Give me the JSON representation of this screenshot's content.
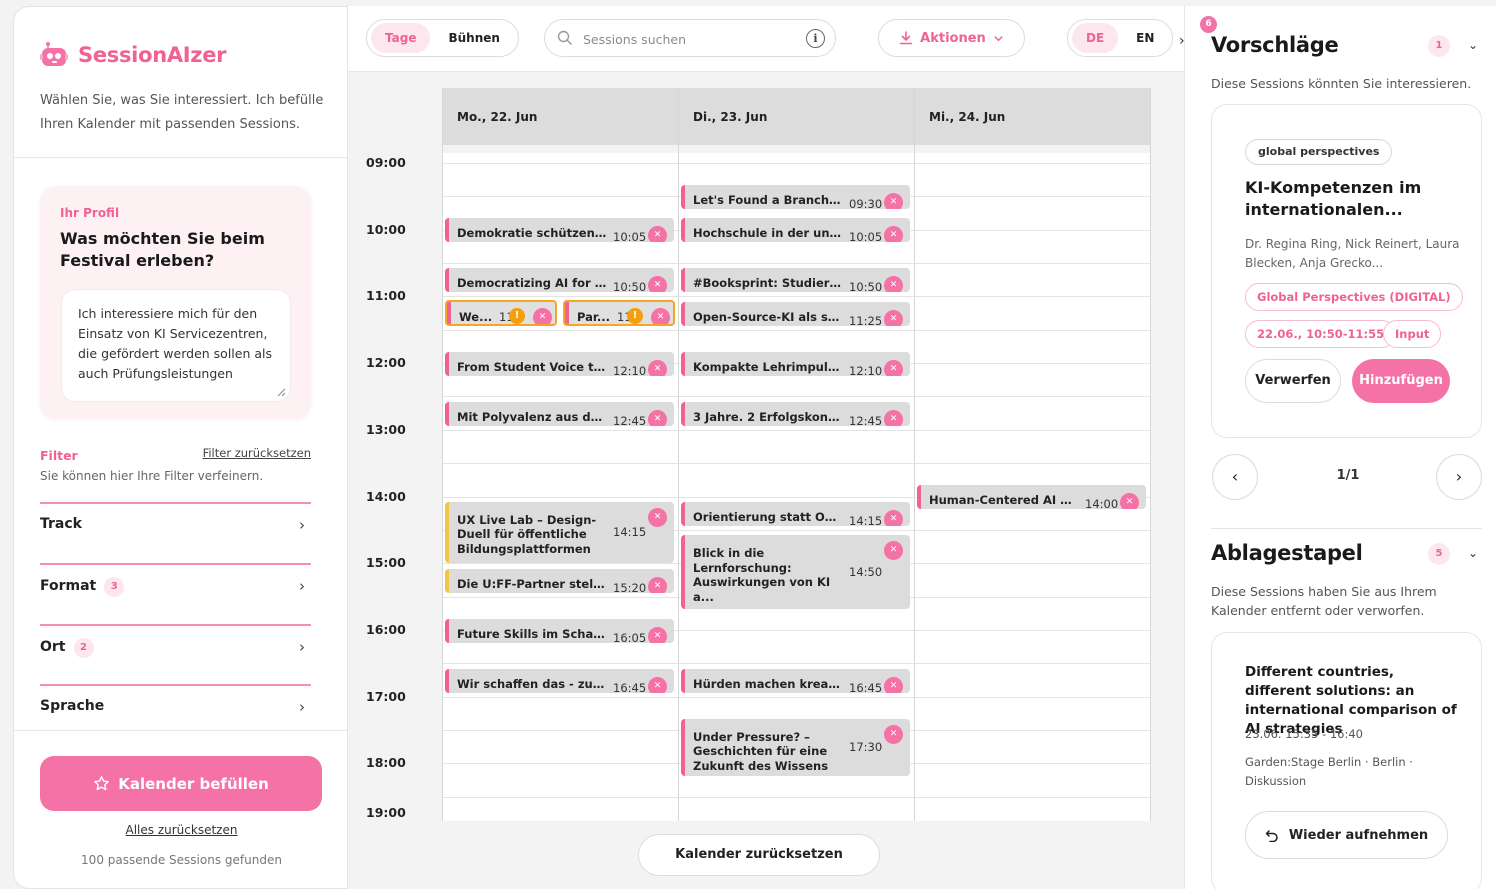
{
  "brand": {
    "name": "SessionAIzer"
  },
  "sidebar": {
    "intro": "Wählen Sie, was Sie interessiert. Ich befülle Ihren Kalender mit passenden Sessions.",
    "profile": {
      "label": "Ihr Profil",
      "question": "Was möchten Sie beim Festival erleben?",
      "text": "Ich interessiere mich für den Einsatz von KI Servicezentren, die gefördert werden sollen als auch Prüfungsleistungen"
    },
    "filter": {
      "title": "Filter",
      "reset": "Filter zurücksetzen",
      "subtitle": "Sie können hier Ihre Filter verfeinern.",
      "items": [
        {
          "label": "Track",
          "count": ""
        },
        {
          "label": "Format",
          "count": "3"
        },
        {
          "label": "Ort",
          "count": "2"
        },
        {
          "label": "Sprache",
          "count": ""
        }
      ]
    },
    "fill_button": "Kalender befüllen",
    "reset_all": "Alles zurücksetzen",
    "found": "100 passende Sessions gefunden"
  },
  "toolbar": {
    "view_tabs": [
      "Tage",
      "Bühnen"
    ],
    "search_placeholder": "Sessions suchen",
    "actions_label": "Aktionen",
    "languages": [
      "DE",
      "EN"
    ]
  },
  "calendar": {
    "days": [
      "Mo., 22. Jun",
      "Di., 23. Jun",
      "Mi., 24. Jun"
    ],
    "hours": [
      "09:00",
      "10:00",
      "11:00",
      "12:00",
      "13:00",
      "14:00",
      "15:00",
      "16:00",
      "17:00",
      "18:00",
      "19:00"
    ],
    "events": [
      {
        "day": 1,
        "title": "Let's Found a Branch C...",
        "time": "09:30",
        "start": 9.33,
        "end": 9.75
      },
      {
        "day": 0,
        "title": "Demokratie schützen! ...",
        "time": "10:05",
        "start": 9.83,
        "end": 10.25
      },
      {
        "day": 1,
        "title": "Hochschule in der unge...",
        "time": "10:05",
        "start": 9.83,
        "end": 10.25
      },
      {
        "day": 0,
        "title": "Democratizing AI for E...",
        "time": "10:50",
        "start": 10.58,
        "end": 11.0
      },
      {
        "day": 1,
        "title": "#Booksprint: Studieren...",
        "time": "10:50",
        "start": 10.58,
        "end": 11.0
      },
      {
        "day": 0,
        "title": "We...",
        "time": "11:",
        "start": 11.05,
        "end": 11.5,
        "conflict": true,
        "half": 0
      },
      {
        "day": 0,
        "title": "Par...",
        "time": "11:",
        "start": 11.05,
        "end": 11.5,
        "conflict": true,
        "half": 1
      },
      {
        "day": 1,
        "title": "Open-Source-KI als str...",
        "time": "11:25",
        "start": 11.08,
        "end": 11.5
      },
      {
        "day": 0,
        "title": "From Student Voice to S...",
        "time": "12:10",
        "start": 11.83,
        "end": 12.25
      },
      {
        "day": 1,
        "title": "Kompakte Lehrimpulse:...",
        "time": "12:10",
        "start": 11.83,
        "end": 12.25
      },
      {
        "day": 0,
        "title": "Mit Polyvalenz aus der ...",
        "time": "12:45",
        "start": 12.58,
        "end": 13.0
      },
      {
        "day": 1,
        "title": "3 Jahre. 2 Erfolgskonze...",
        "time": "12:45",
        "start": 12.58,
        "end": 13.0
      },
      {
        "day": 2,
        "title": "Human-Centered AI an...",
        "time": "14:00",
        "start": 13.83,
        "end": 14.25
      },
      {
        "day": 0,
        "title": "UX Live Lab – Design-Duell für öffentliche Bildungsplattformen",
        "time": "14:15",
        "start": 14.08,
        "end": 15.05,
        "multi": true,
        "yellow": true
      },
      {
        "day": 1,
        "title": "Orientierung statt Over...",
        "time": "14:15",
        "start": 14.08,
        "end": 14.5
      },
      {
        "day": 1,
        "title": "Blick in die Lernforschung: Auswirkungen von KI a...",
        "time": "14:50",
        "start": 14.58,
        "end": 15.75,
        "multi": true
      },
      {
        "day": 0,
        "title": "Die U:FF-Partner stelle...",
        "time": "15:20",
        "start": 15.08,
        "end": 15.5,
        "yellow": true
      },
      {
        "day": 0,
        "title": "Future Skills im Schauf...",
        "time": "16:05",
        "start": 15.83,
        "end": 16.25
      },
      {
        "day": 0,
        "title": "Wir schaffen das - zusa...",
        "time": "16:45",
        "start": 16.58,
        "end": 17.0
      },
      {
        "day": 1,
        "title": "Hürden machen kreativ...",
        "time": "16:45",
        "start": 16.58,
        "end": 17.0
      },
      {
        "day": 1,
        "title": "Under Pressure? – Geschichten für eine Zukunft des Wissens",
        "time": "17:30",
        "start": 17.33,
        "end": 18.25,
        "multi": true
      }
    ],
    "reset_label": "Kalender zurücksetzen"
  },
  "right_panel": {
    "notification_count": "6",
    "suggestions": {
      "title": "Vorschläge",
      "count": "1",
      "description": "Diese Sessions könnten Sie interessieren.",
      "card": {
        "tag": "global perspectives",
        "title": "KI-Kompetenzen im internationalen...",
        "authors": "Dr. Regina Ring, Nick Reinert, Laura Blecken, Anja Grecko...",
        "track": "Global Perspectives (DIGITAL)",
        "datetime": "22.06., 10:50-11:55",
        "format": "Input",
        "discard": "Verwerfen",
        "add": "Hinzufügen"
      },
      "pager": "1/1"
    },
    "stack": {
      "title": "Ablagestapel",
      "count": "5",
      "description": "Diese Sessions haben Sie aus Ihrem Kalender entfernt oder verworfen.",
      "card": {
        "title": "Different countries, different solutions: an international comparison of AI strategies",
        "meta": "23.06. 15:35 - 16:40",
        "location": "Garden:Stage Berlin · Berlin · Diskussion",
        "restore": "Wieder aufnehmen"
      }
    }
  },
  "colors": {
    "accent": "#f06292",
    "accent_fill": "#f472a6",
    "accent_soft": "#fde7ee",
    "event": "#dcdcdc",
    "warn": "#f59e0b",
    "yellow": "#f5c542"
  }
}
